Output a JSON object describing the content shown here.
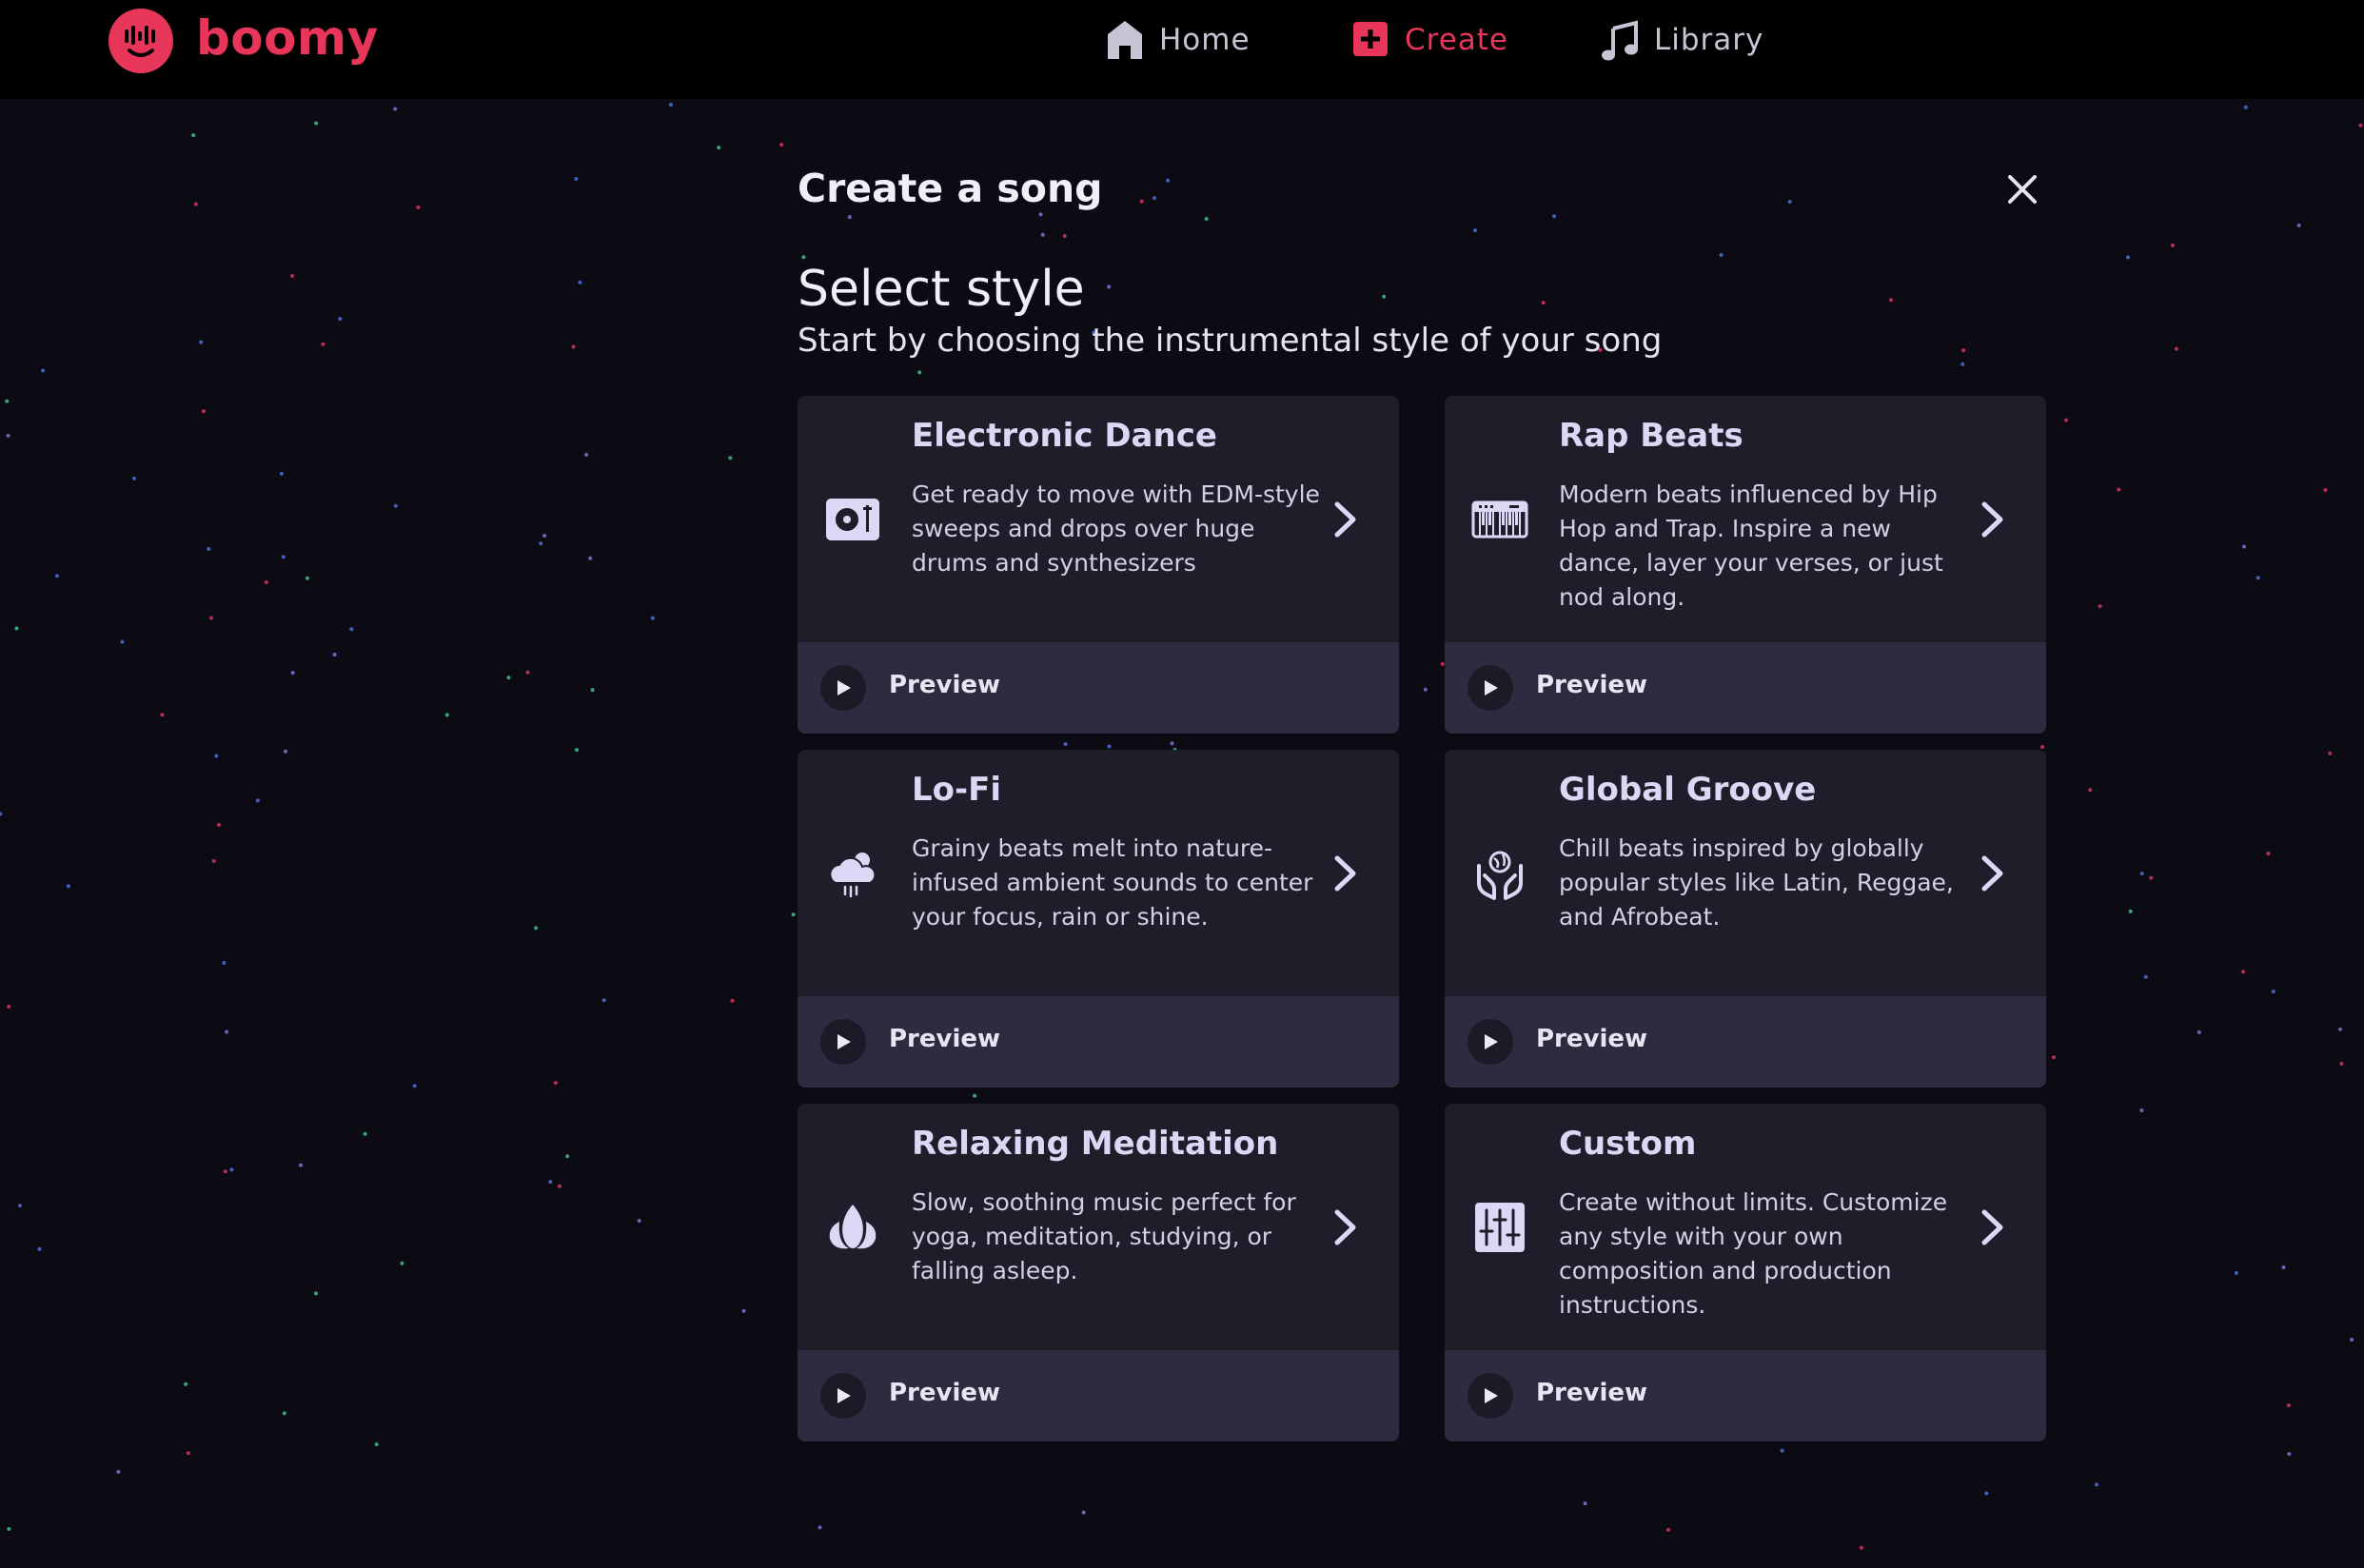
{
  "app": {
    "logo_text": "boomy"
  },
  "nav": [
    {
      "id": "home",
      "label": "Home",
      "icon": "home-icon"
    },
    {
      "id": "create",
      "label": "Create",
      "icon": "plus-square-icon",
      "active": true
    },
    {
      "id": "library",
      "label": "Library",
      "icon": "music-note-icon"
    }
  ],
  "dialog": {
    "title": "Create a song",
    "step_title": "Select style",
    "step_subtitle": "Start by choosing the instrumental style of your song"
  },
  "styles": [
    {
      "title": "Electronic Dance",
      "desc": "Get ready to move with EDM-style sweeps and drops over huge drums and synthesizers",
      "icon": "turntable-icon",
      "preview": "Preview"
    },
    {
      "title": "Rap Beats",
      "desc": "Modern beats influenced by Hip Hop and Trap. Inspire a new dance, layer your verses, or just nod along.",
      "icon": "keyboard-icon",
      "preview": "Preview"
    },
    {
      "title": "Lo-Fi",
      "desc": "Grainy beats melt into nature-infused ambient sounds to center your focus, rain or shine.",
      "icon": "cloud-rain-icon",
      "preview": "Preview"
    },
    {
      "title": "Global Groove",
      "desc": "Chill beats inspired by globally popular styles like Latin, Reggae, and Afrobeat.",
      "icon": "hands-globe-icon",
      "preview": "Preview"
    },
    {
      "title": "Relaxing Meditation",
      "desc": "Slow, soothing music perfect for yoga, meditation, studying, or falling asleep.",
      "icon": "lotus-icon",
      "preview": "Preview"
    },
    {
      "title": "Custom",
      "desc": "Create without limits. Customize any style with your own composition and production instructions.",
      "icon": "sliders-icon",
      "preview": "Preview"
    }
  ],
  "colors": {
    "brand": "#e8365b",
    "card": "#1e1d29",
    "card_footer": "#2d2b40",
    "icon": "#ddd7f5"
  }
}
